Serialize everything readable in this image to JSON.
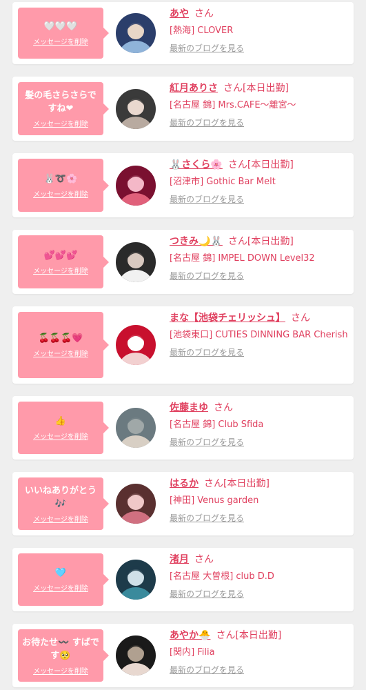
{
  "colors": {
    "accent": "#e0405f",
    "bubble": "#ff9aaa",
    "muted": "#999999",
    "background": "#efefef"
  },
  "cards": [
    {
      "message": "🤍🤍🤍",
      "delete_label": "メッセージを削除",
      "avatar_icon": "avatar-photo",
      "name": "あや",
      "suffix": "さん",
      "shop": "[熱海] CLOVER",
      "blog_label": "最新のブログを見る"
    },
    {
      "message": "髪の毛さらさらですね❤",
      "delete_label": "メッセージを削除",
      "avatar_icon": "avatar-photo",
      "name": "紅月ありさ",
      "suffix": "さん[本日出勤]",
      "shop": "[名古屋 錦] Mrs.CAFE～離宮～",
      "blog_label": "最新のブログを見る"
    },
    {
      "message": "🐰➰🌸",
      "delete_label": "メッセージを削除",
      "avatar_icon": "avatar-photo",
      "name": "🐰さくら🌸",
      "suffix": "さん[本日出勤]",
      "shop": "[沼津市] Gothic Bar Melt",
      "blog_label": "最新のブログを見る"
    },
    {
      "message": "💕💕💕",
      "delete_label": "メッセージを削除",
      "avatar_icon": "avatar-photo",
      "name": "つきみ🌙🐰",
      "suffix": "さん[本日出勤]",
      "shop": "[名古屋 錦] IMPEL DOWN Level32",
      "blog_label": "最新のブログを見る"
    },
    {
      "message": "🍒🍒🍒💗",
      "delete_label": "メッセージを削除",
      "avatar_icon": "avatar-photo",
      "name": "まな【池袋チェリッシュ】",
      "suffix": "さん",
      "shop": "[池袋東口] CUTIES DINNING BAR Cherish",
      "blog_label": "最新のブログを見る"
    },
    {
      "message": "👍",
      "delete_label": "メッセージを削除",
      "avatar_icon": "avatar-photo",
      "name": "佐藤まゆ",
      "suffix": "さん",
      "shop": "[名古屋 錦] Club Sfida",
      "blog_label": "最新のブログを見る"
    },
    {
      "message": "いいねありがとう🎶",
      "delete_label": "メッセージを削除",
      "avatar_icon": "avatar-photo",
      "name": "はるか",
      "suffix": "さん[本日出勤]",
      "shop": "[神田] Venus garden",
      "blog_label": "最新のブログを見る"
    },
    {
      "message": "🩵",
      "delete_label": "メッセージを削除",
      "avatar_icon": "avatar-photo",
      "name": "渚月",
      "suffix": "さん",
      "shop": "[名古屋 大曽根] club D.D",
      "blog_label": "最新のブログを見る"
    },
    {
      "message": "お待たせ〰️ すばです🥺",
      "delete_label": "メッセージを削除",
      "avatar_icon": "avatar-photo",
      "name": "あやか🐣",
      "suffix": "さん[本日出勤]",
      "shop": "[関内] Filia",
      "blog_label": "最新のブログを見る"
    }
  ]
}
